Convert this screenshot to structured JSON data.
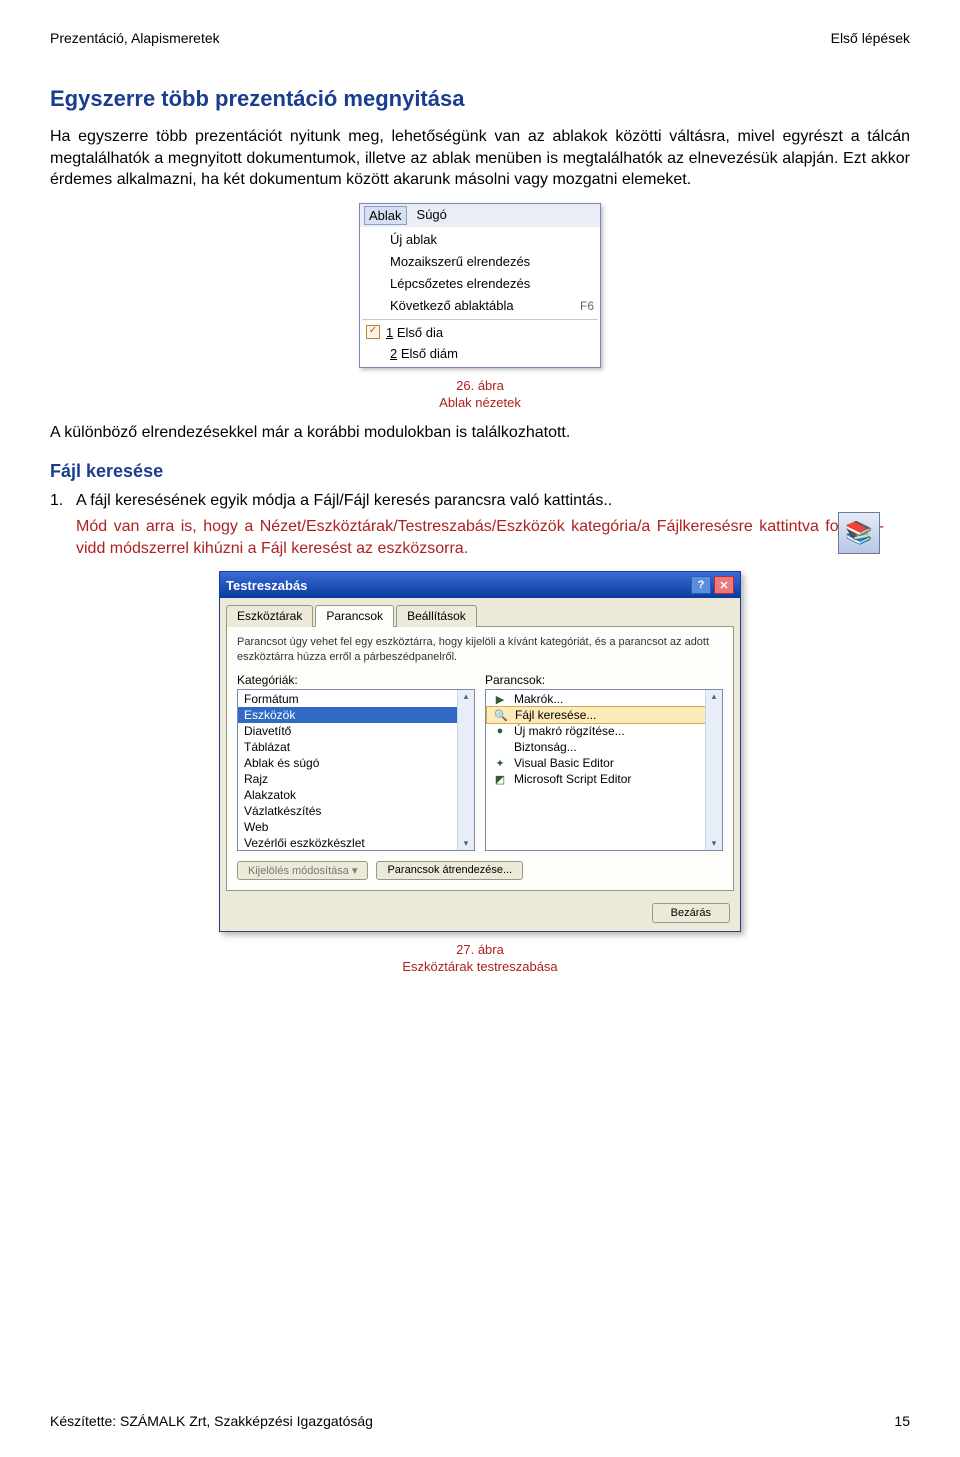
{
  "header": {
    "left": "Prezentáció, Alapismeretek",
    "right": "Első lépések"
  },
  "section1": {
    "title": "Egyszerre több prezentáció megnyitása",
    "para": "Ha egyszerre több prezentációt nyitunk meg, lehetőségünk van az ablakok közötti váltásra, mivel egyrészt a tálcán megtalálhatók a megnyitott dokumentumok, illetve az ablak menüben is megtalálhatók az elnevezésük alapján. Ezt akkor érdemes alkalmazni, ha két dokumentum között akarunk másolni vagy mozgatni elemeket."
  },
  "ablak_menu": {
    "bar": [
      "Ablak",
      "Súgó"
    ],
    "items": [
      {
        "icon": "",
        "label": "Új ablak",
        "shortcut": ""
      },
      {
        "icon": "",
        "label": "Mozaikszerű elrendezés",
        "shortcut": ""
      },
      {
        "icon": "",
        "label": "Lépcsőzetes elrendezés",
        "shortcut": ""
      },
      {
        "icon": "",
        "label": "Következő ablaktábla",
        "shortcut": "F6"
      },
      {
        "sep": true
      },
      {
        "icon": "✓",
        "label": "1 Első dia",
        "shortcut": ""
      },
      {
        "icon": "",
        "label": "2 Első diám",
        "shortcut": ""
      }
    ]
  },
  "caption1": {
    "line1": "26. ábra",
    "line2": "Ablak nézetek"
  },
  "para_after": "A különböző elrendezésekkel már a korábbi modulokban is találkozhatott.",
  "section2": {
    "title": "Fájl keresése",
    "num": "1.",
    "numtext": "A fájl keresésének egyik módja a Fájl/Fájl keresés parancsra való kattintás..",
    "rednote": "Mód van arra is, hogy a Nézet/Eszköztárak/Testreszabás/Eszközök kategória/a Fájlkeresésre kattintva fogd-és-vidd módszerrel kihúzni a Fájl keresést az eszközsorra."
  },
  "dialog": {
    "title": "Testreszabás",
    "tabs": [
      "Eszköztárak",
      "Parancsok",
      "Beállítások"
    ],
    "active_tab": 1,
    "instr": "Parancsot úgy vehet fel egy eszköztárra, hogy kijelöli a kívánt kategóriát, és a parancsot az adott eszköztárra húzza erről a párbeszédpanelről.",
    "left_label": "Kategóriák:",
    "right_label": "Parancsok:",
    "left_items": [
      "Formátum",
      "Eszközök",
      "Diavetítő",
      "Táblázat",
      "Ablak és súgó",
      "Rajz",
      "Alakzatok",
      "Vázlatkészítés",
      "Web",
      "Vezérlői eszközkészlet"
    ],
    "left_selected": 1,
    "right_items": [
      {
        "icon": "▶",
        "label": "Makrók..."
      },
      {
        "icon": "🔍",
        "label": "Fájl keresése..."
      },
      {
        "icon": "●",
        "label": "Új makró rögzítése..."
      },
      {
        "icon": "",
        "label": "Biztonság..."
      },
      {
        "icon": "✦",
        "label": "Visual Basic Editor"
      },
      {
        "icon": "◩",
        "label": "Microsoft Script Editor"
      }
    ],
    "right_highlight": 1,
    "modify_btn": "Kijelölés módosítása ▾",
    "rearrange_btn": "Parancsok átrendezése...",
    "close_btn": "Bezárás"
  },
  "caption2": {
    "line1": "27. ábra",
    "line2": "Eszköztárak testreszabása"
  },
  "footer": {
    "left": "Készítette: SZÁMALK Zrt, Szakképzési Igazgatóság",
    "right": "15"
  }
}
